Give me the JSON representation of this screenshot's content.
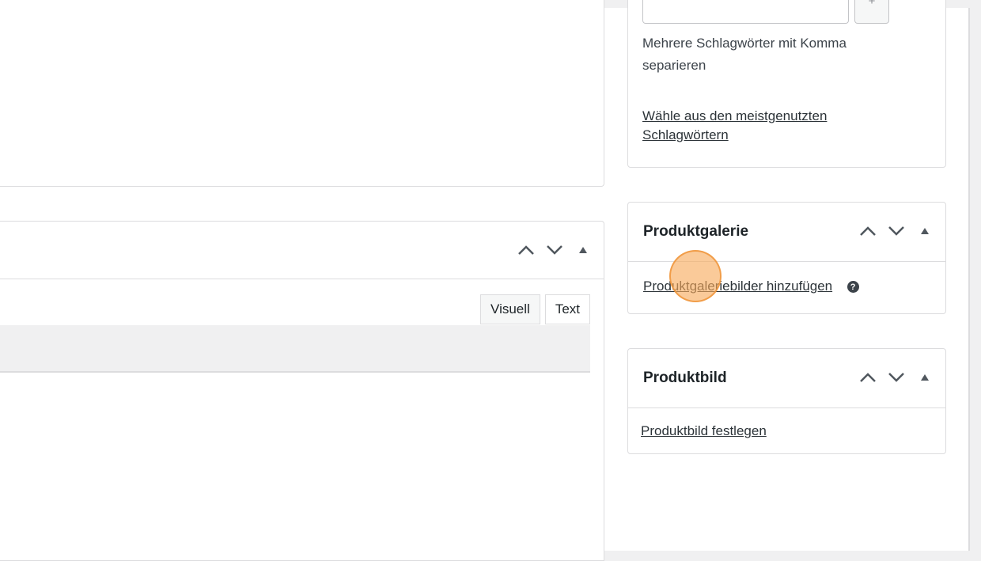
{
  "tags_box": {
    "add_button_label": "+",
    "help_text": "Mehrere Schlagwörter mit Komma separieren",
    "most_used_link": "Wähle aus den meistgenutzten Schlagwörtern"
  },
  "description_box": {
    "tab_visual": "Visuell",
    "tab_text": "Text"
  },
  "product_gallery": {
    "title": "Produktgalerie",
    "add_images_link": "Produktgaleriebilder hinzufügen",
    "help_icon_glyph": "?"
  },
  "product_image": {
    "title": "Produktbild",
    "set_image_link": "Produktbild festlegen"
  },
  "icons": {
    "move_up": "chevron-up-icon",
    "move_down": "chevron-down-icon",
    "toggle": "caret-up-icon"
  },
  "colors": {
    "link": "#2c3338",
    "border": "#dcdcde",
    "click_marker": "#f7aa5a"
  }
}
